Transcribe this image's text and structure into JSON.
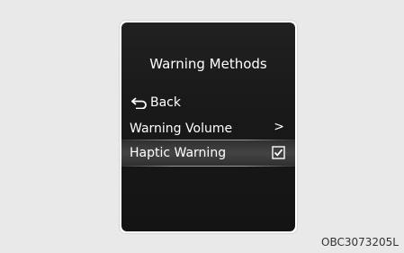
{
  "screen": {
    "title": "Warning Methods",
    "back_label": "Back",
    "items": [
      {
        "label": "Warning Volume",
        "icon": "chevron-right-icon",
        "chevron": ">"
      },
      {
        "label": "Haptic Warning",
        "icon": "checkbox-checked-icon",
        "checked": true,
        "selected": true
      }
    ]
  },
  "figure_code": "OBC3073205L",
  "colors": {
    "page_background": "#e9e9e9",
    "screen_background": "#191919",
    "text": "#ffffff",
    "highlight_line": "#9a9a9a"
  }
}
